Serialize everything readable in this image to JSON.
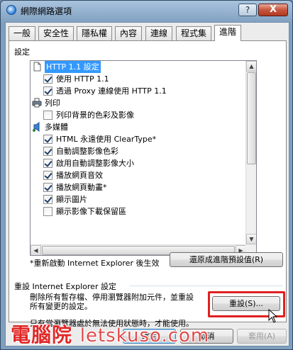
{
  "window": {
    "title": "網際網路選項",
    "help_glyph": "?",
    "close_glyph": "X"
  },
  "tabs": [
    {
      "label": "一般"
    },
    {
      "label": "安全性"
    },
    {
      "label": "隱私權"
    },
    {
      "label": "內容"
    },
    {
      "label": "連線"
    },
    {
      "label": "程式集"
    },
    {
      "label": "進階",
      "active": true
    }
  ],
  "settings": {
    "label": "設定",
    "rows": [
      {
        "type": "category",
        "icon": "page-icon",
        "label": "HTTP 1.1 設定",
        "selected": true
      },
      {
        "type": "checkbox",
        "checked": true,
        "label": "使用 HTTP 1.1"
      },
      {
        "type": "checkbox",
        "checked": true,
        "label": "透過 Proxy 連線使用 HTTP 1.1"
      },
      {
        "type": "category",
        "icon": "printer-icon",
        "label": "列印"
      },
      {
        "type": "checkbox",
        "checked": false,
        "label": "列印背景的色彩及影像"
      },
      {
        "type": "category",
        "icon": "multimedia-icon",
        "label": "多媒體"
      },
      {
        "type": "checkbox",
        "checked": true,
        "label": "HTML 永遠使用 ClearType*"
      },
      {
        "type": "checkbox",
        "checked": true,
        "label": "自動調整影像色彩"
      },
      {
        "type": "checkbox",
        "checked": true,
        "label": "啟用自動調整影像大小"
      },
      {
        "type": "checkbox",
        "checked": true,
        "label": "播放網頁音效"
      },
      {
        "type": "checkbox",
        "checked": true,
        "label": "播放網頁動畫*"
      },
      {
        "type": "checkbox",
        "checked": true,
        "label": "顯示圖片"
      },
      {
        "type": "checkbox",
        "checked": false,
        "label": "顯示影像下載保留區"
      }
    ]
  },
  "restart_note": "*重新啟動 Internet Explorer 後生效",
  "restore_button": "還原成進階預設值(R)",
  "reset_group": {
    "title": "重設 Internet Explorer 設定",
    "description": "刪除所有暫存檔、停用瀏覽器附加元件，並重設所有變更的設定。",
    "reset_button": "重設(S)...",
    "note": "只有當瀏覽器處於無法使用狀態時，才能使用。"
  },
  "footer": {
    "ok": "確定",
    "cancel": "取消",
    "apply": "套用(A)"
  },
  "watermark": {
    "cjk": "電腦院",
    "latin": "letskuso.com"
  }
}
